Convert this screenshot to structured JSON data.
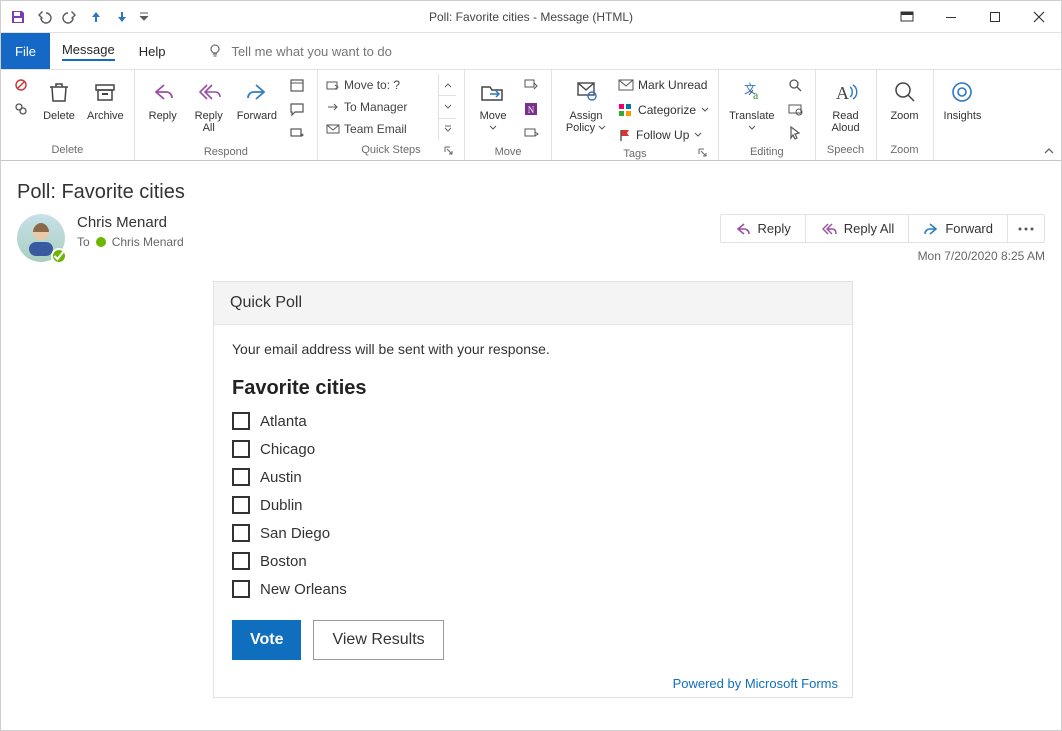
{
  "window": {
    "title": "Poll: Favorite cities  -  Message (HTML)"
  },
  "qat": {
    "save": "Save",
    "undo": "Undo",
    "redo": "Redo",
    "prev": "Previous Item",
    "next": "Next Item",
    "custom": "Customize"
  },
  "tabs": {
    "file": "File",
    "message": "Message",
    "help": "Help",
    "tell_me_placeholder": "Tell me what you want to do"
  },
  "ribbon": {
    "delete_group": "Delete",
    "delete": "Delete",
    "archive": "Archive",
    "respond_group": "Respond",
    "reply": "Reply",
    "reply_all": "Reply All",
    "forward": "Forward",
    "quicksteps_group": "Quick Steps",
    "qs_moveto": "Move to: ?",
    "qs_tomanager": "To Manager",
    "qs_teamemail": "Team Email",
    "move_group": "Move",
    "move": "Move",
    "tags_group": "Tags",
    "assign_policy": "Assign Policy",
    "mark_unread": "Mark Unread",
    "categorize": "Categorize",
    "followup": "Follow Up",
    "editing_group": "Editing",
    "translate": "Translate",
    "speech_group": "Speech",
    "read_aloud": "Read Aloud",
    "zoom_group": "Zoom",
    "zoom": "Zoom",
    "insights": "Insights"
  },
  "message": {
    "subject": "Poll: Favorite cities",
    "from": "Chris Menard",
    "to_label": "To",
    "to_recipient": "Chris Menard",
    "timestamp": "Mon 7/20/2020 8:25 AM"
  },
  "actions": {
    "reply": "Reply",
    "reply_all": "Reply All",
    "forward": "Forward"
  },
  "poll": {
    "header": "Quick Poll",
    "note": "Your email address will be sent with your response.",
    "question": "Favorite cities",
    "options": [
      "Atlanta",
      "Chicago",
      "Austin",
      "Dublin",
      "San Diego",
      "Boston",
      "New Orleans"
    ],
    "vote_label": "Vote",
    "view_results_label": "View Results",
    "footer_link": "Powered by Microsoft Forms"
  }
}
